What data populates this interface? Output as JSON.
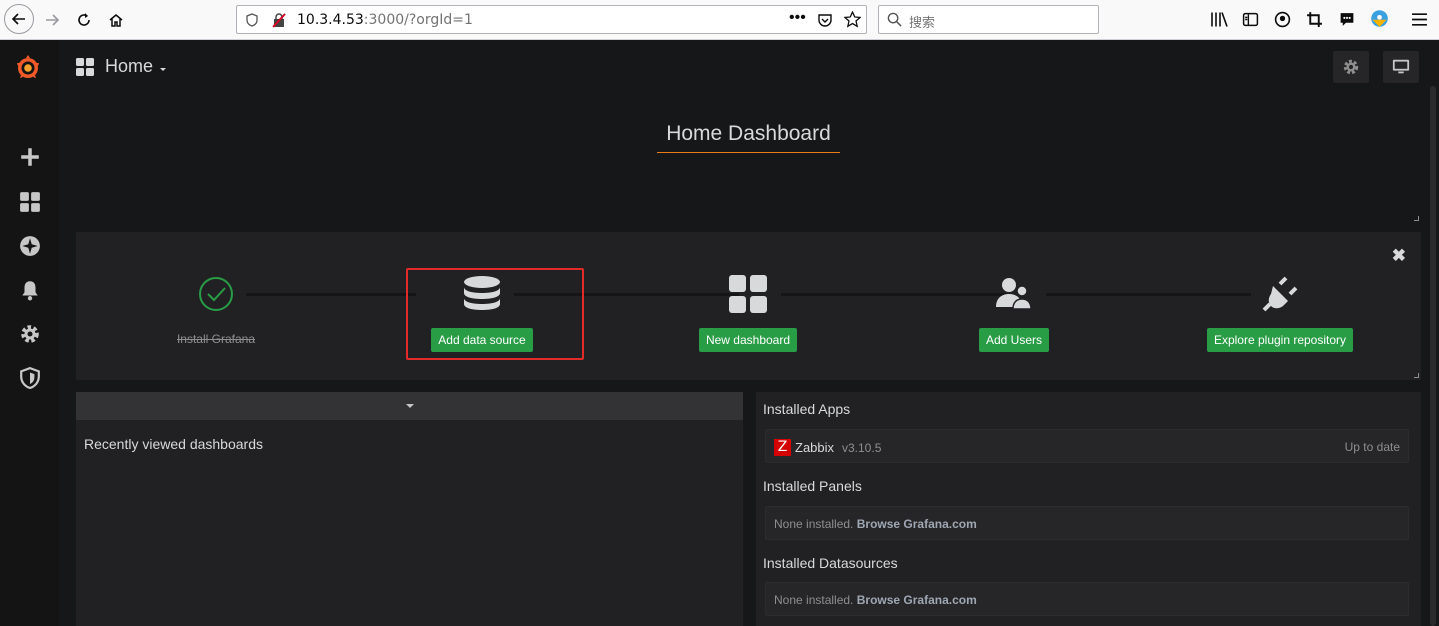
{
  "browser": {
    "url_host": "10.3.4.53",
    "url_rest": ":3000/?orgId=1",
    "search_placeholder": "搜索"
  },
  "nav": {
    "title": "Home",
    "icons": [
      "grid-icon",
      "caret-down-icon",
      "settings-icon",
      "tv-icon"
    ]
  },
  "sidebar": {
    "icons": [
      "grafana-logo",
      "plus-icon",
      "dashboards-icon",
      "explore-icon",
      "bell-icon",
      "gear-icon",
      "shield-icon"
    ]
  },
  "home_title": "Home Dashboard",
  "steps": [
    {
      "label": "Install Grafana",
      "done": true
    },
    {
      "label": "Add data source"
    },
    {
      "label": "New dashboard"
    },
    {
      "label": "Add Users"
    },
    {
      "label": "Explore plugin repository"
    }
  ],
  "recent": {
    "title": "Recently viewed dashboards"
  },
  "plugins": {
    "apps_title": "Installed Apps",
    "app": {
      "name": "Zabbix",
      "version": "v3.10.5",
      "status": "Up to date",
      "icon_letter": "Z"
    },
    "panels_title": "Installed Panels",
    "panels_none": "None installed.",
    "panels_link": "Browse Grafana.com",
    "datasources_title": "Installed Datasources",
    "datasources_none": "None installed.",
    "datasources_link": "Browse Grafana.com"
  },
  "colors": {
    "accent": "#eb7b18",
    "button_green": "#299c46",
    "highlight_red": "#e32a2a"
  }
}
